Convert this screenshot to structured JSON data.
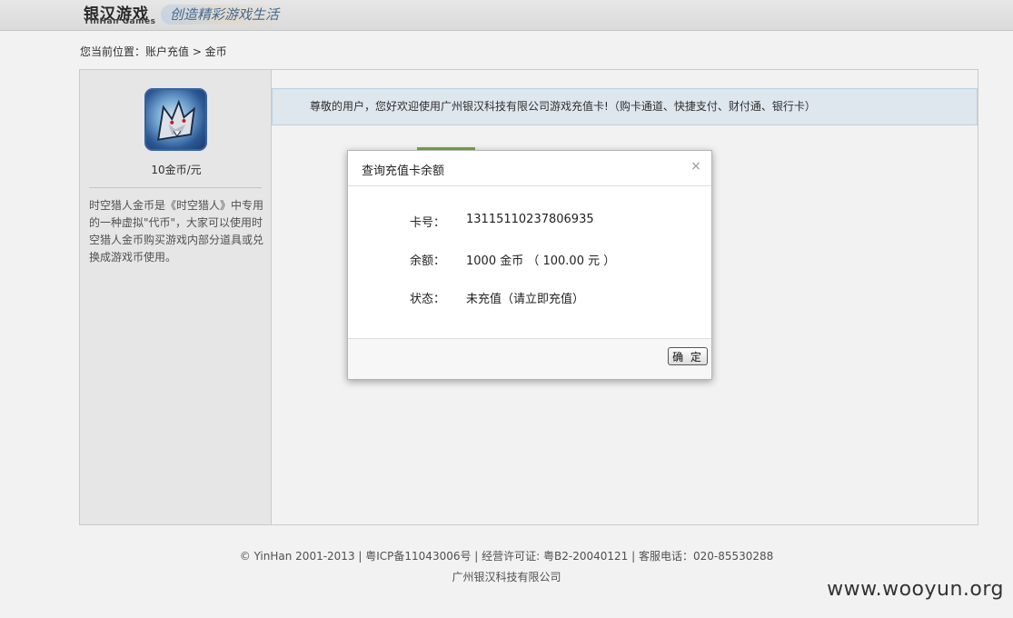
{
  "header": {
    "logo_cn": "银汉游戏",
    "logo_en": "YinHan Games",
    "slogan": "创造精彩游戏生活"
  },
  "breadcrumb": "您当前位置：账户充值 > 金币",
  "sidebar": {
    "game_icon": "game-wolf-avatar-icon",
    "price": "10金币/元",
    "description": "时空猎人金币是《时空猎人》中专用的一种虚拟\"代币\"，大家可以使用时空猎人金币购买游戏内部分道具或兑换成游戏币使用。"
  },
  "content": {
    "welcome": "尊敬的用户，您好欢迎使用广州银汉科技有限公司游戏充值卡!（购卡通道、快捷支付、财付通、银行卡）",
    "tab_color": "#7bb34a"
  },
  "dialog": {
    "title": "查询充值卡余额",
    "close_icon": "close-icon",
    "fields": [
      {
        "label": "卡号：",
        "value": "13115110237806935"
      },
      {
        "label": "余额：",
        "value": "1000 金币 （ 100.00 元 ）"
      },
      {
        "label": "状态：",
        "value": "未充值（请立即充值）"
      }
    ],
    "ok_label": "确 定"
  },
  "footer": {
    "line1": "© YinHan 2001-2013 |  粤ICP备11043006号 | 经营许可证: 粤B2-20040121 | 客服电话：020-85530288",
    "line2": "广州银汉科技有限公司"
  },
  "watermark": "www.wooyun.org"
}
